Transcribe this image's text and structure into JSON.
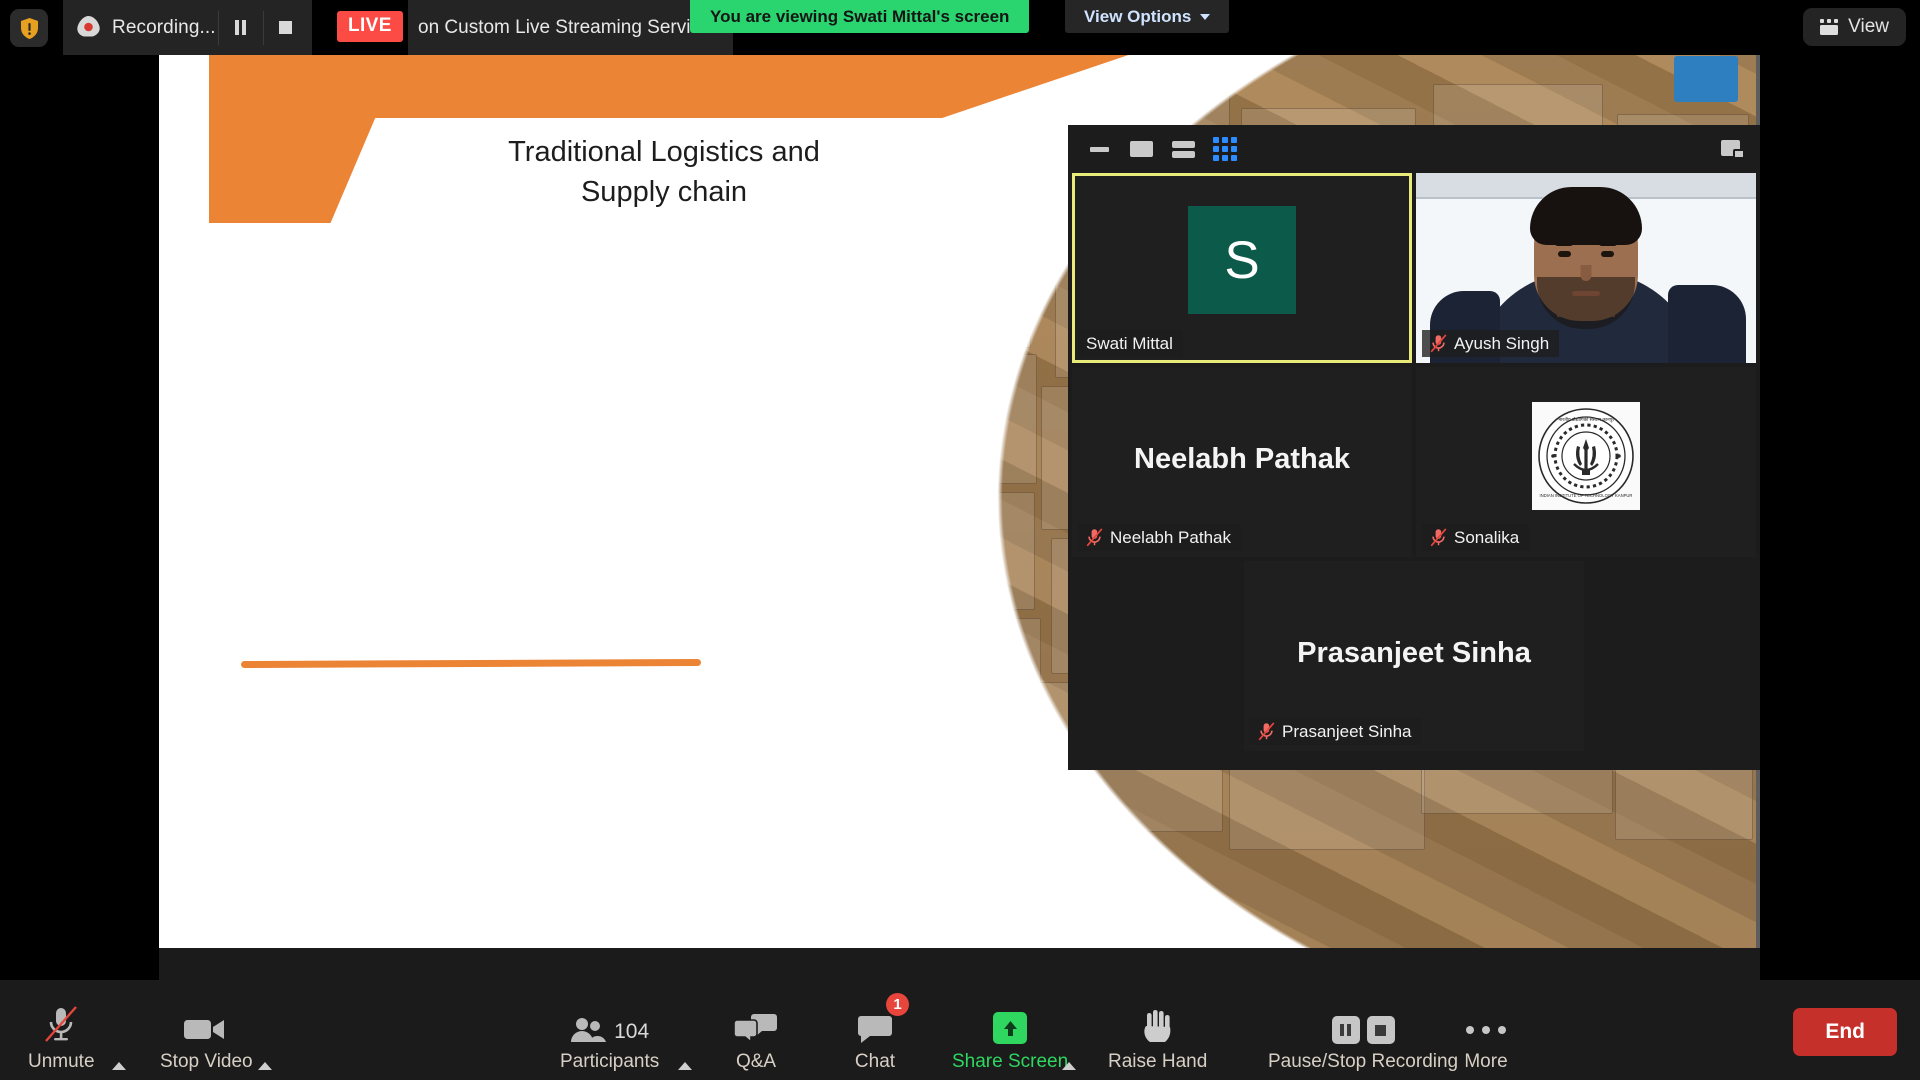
{
  "topbar": {
    "security_icon": "shield-warning-icon",
    "recording": {
      "icon": "recording-dot-icon",
      "label": "Recording...",
      "pause_icon": "pause-icon",
      "stop_icon": "stop-icon"
    },
    "live": {
      "badge": "LIVE",
      "service_text": "on Custom Live Streaming Service"
    },
    "viewing_banner": "You are viewing Swati Mittal's screen",
    "view_options": {
      "label": "View Options",
      "chevron": "chevron-down-icon"
    },
    "view_button": {
      "label": "View",
      "icon": "gallery-grid-icon"
    }
  },
  "shared_screen": {
    "slide_title_line1": "Traditional Logistics and",
    "slide_title_line2": "Supply chain",
    "accent_color": "#ec8436",
    "prev_arrow": "‹"
  },
  "panel": {
    "layout_buttons": [
      {
        "name": "minimize-view-button",
        "active": false
      },
      {
        "name": "active-speaker-view-button",
        "active": false
      },
      {
        "name": "stacked-view-button",
        "active": false
      },
      {
        "name": "gallery-view-button",
        "active": true
      }
    ],
    "popout_button": "picture-in-picture-button",
    "active_border_color": "#e8ea7a",
    "tiles": [
      {
        "name": "Swati Mittal",
        "display_mode": "initial",
        "initial": "S",
        "avatar_color": "#0b5a4a",
        "muted": false,
        "active_speaker": true
      },
      {
        "name": "Ayush Singh",
        "display_mode": "video",
        "muted": true,
        "active_speaker": false
      },
      {
        "name": "Neelabh Pathak",
        "display_mode": "name",
        "big_name": "Neelabh Pathak",
        "muted": true,
        "active_speaker": false
      },
      {
        "name": "Sonalika",
        "display_mode": "seal",
        "seal_label": "institute-seal-icon",
        "muted": true,
        "active_speaker": false
      },
      {
        "name": "Prasanjeet Sinha",
        "display_mode": "name",
        "big_name": "Prasanjeet Sinha",
        "muted": true,
        "active_speaker": false
      }
    ]
  },
  "controls": [
    {
      "id": "unmute",
      "label": "Unmute",
      "icon": "microphone-muted-icon",
      "caret": true
    },
    {
      "id": "stop-video",
      "label": "Stop Video",
      "icon": "video-camera-icon",
      "caret": true
    },
    {
      "id": "participants",
      "label": "Participants",
      "icon": "participants-icon",
      "caret": true,
      "count": "104"
    },
    {
      "id": "qa",
      "label": "Q&A",
      "icon": "qa-bubbles-icon",
      "caret": false
    },
    {
      "id": "chat",
      "label": "Chat",
      "icon": "chat-bubble-icon",
      "caret": false,
      "badge": "1"
    },
    {
      "id": "share-screen",
      "label": "Share Screen",
      "icon": "share-screen-up-arrow-icon",
      "caret": true,
      "accent": "#2fd65f"
    },
    {
      "id": "raise-hand",
      "label": "Raise Hand",
      "icon": "raised-hand-icon",
      "caret": false
    },
    {
      "id": "recording",
      "label": "Pause/Stop Recording",
      "icon": "pause-stop-recording-icon",
      "caret": false
    },
    {
      "id": "more",
      "label": "More",
      "icon": "ellipsis-icon",
      "caret": false
    }
  ],
  "end_button": {
    "label": "End",
    "color": "#c5302b"
  }
}
